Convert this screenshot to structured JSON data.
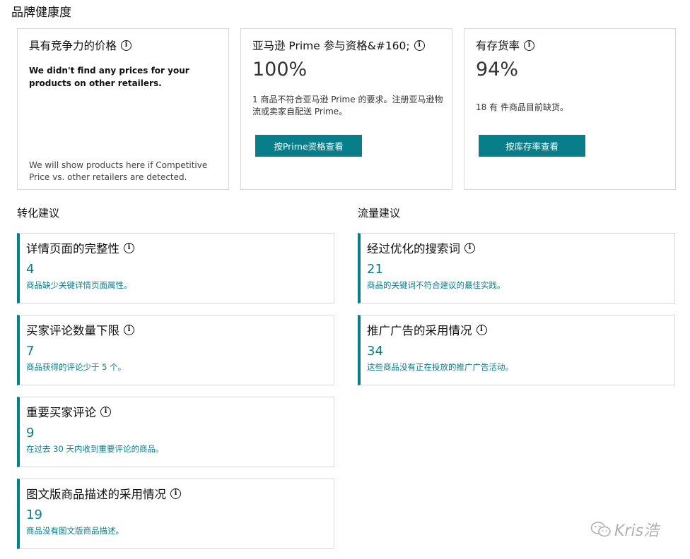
{
  "page": {
    "title": "品牌健康度"
  },
  "top_cards": [
    {
      "title": "具有竞争力的价格",
      "bold_note": "We didn't find any prices for your products on other retailers.",
      "foot_note": "We will show products here if Competitive Price vs. other retailers are detected."
    },
    {
      "title": "亚马逊 Prime 参与资格&#160;",
      "value": "100%",
      "description": "1 商品不符合亚马逊 Prime 的要求。注册亚马逊物流或卖家自配送 Prime。",
      "button_label": "按Prime资格查看"
    },
    {
      "title": "有存货率",
      "value": "94%",
      "description": "18 有 件商品目前缺货。",
      "button_label": "按库存率查看"
    }
  ],
  "conversion": {
    "title": "转化建议",
    "items": [
      {
        "title": "详情页面的完整性",
        "count": "4",
        "description": "商品缺少关键详情页面属性。"
      },
      {
        "title": "买家评论数量下限",
        "count": "7",
        "description": "商品获得的评论少于 5 个。"
      },
      {
        "title": "重要买家评论",
        "count": "9",
        "description": "在过去 30 天内收到重要评论的商品。"
      },
      {
        "title": "图文版商品描述的采用情况",
        "count": "19",
        "description": "商品没有图文版商品描述。"
      }
    ]
  },
  "traffic": {
    "title": "流量建议",
    "items": [
      {
        "title": "经过优化的搜索词",
        "count": "21",
        "description": "商品的关键词不符合建议的最佳实践。"
      },
      {
        "title": "推广广告的采用情况",
        "count": "34",
        "description": "这些商品没有正在投放的推广广告活动。"
      }
    ]
  },
  "info_icon_glyph": "i",
  "watermark": {
    "text": "Kris浩",
    "icon": "wechat-icon"
  },
  "colors": {
    "accent": "#087e8b",
    "border": "#d5d9d9"
  }
}
